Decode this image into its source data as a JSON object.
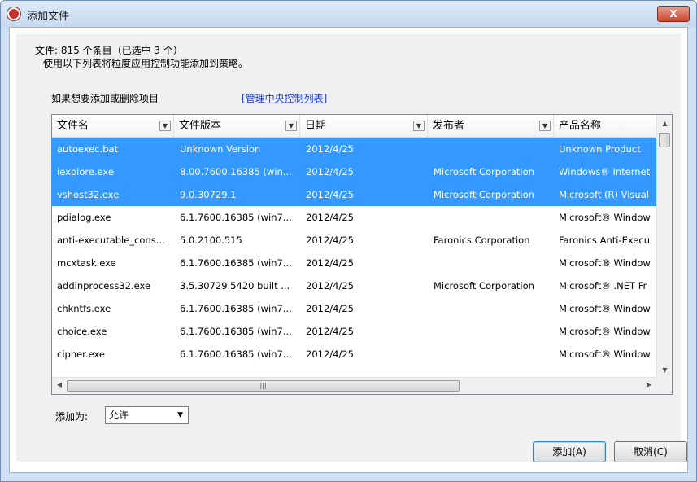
{
  "window": {
    "title": "添加文件",
    "close_label": "X"
  },
  "info": {
    "file_count": "文件: 815 个条目（已选中 3 个）",
    "instruction": "使用以下列表将粒度应用控制功能添加到策略。"
  },
  "edit": {
    "hint": "如果想要添加或删除项目",
    "link": "[管理中央控制列表]"
  },
  "table": {
    "columns": [
      "文件名",
      "文件版本",
      "日期",
      "发布者",
      "产品名称"
    ],
    "rows": [
      {
        "name": "autoexec.bat",
        "version": "Unknown Version",
        "date": "2012/4/25",
        "publisher": "",
        "product": "Unknown Product",
        "selected": true
      },
      {
        "name": "iexplore.exe",
        "version": "8.00.7600.16385 (win...",
        "date": "2012/4/25",
        "publisher": "Microsoft Corporation",
        "product": "Windows® Internet",
        "selected": true
      },
      {
        "name": "vshost32.exe",
        "version": "9.0.30729.1",
        "date": "2012/4/25",
        "publisher": "Microsoft Corporation",
        "product": "Microsoft (R) Visual",
        "selected": true
      },
      {
        "name": "pdialog.exe",
        "version": "6.1.7600.16385 (win7...",
        "date": "2012/4/25",
        "publisher": "",
        "product": "Microsoft® Window",
        "selected": false
      },
      {
        "name": "anti-executable_cons...",
        "version": "5.0.2100.515",
        "date": "2012/4/25",
        "publisher": "Faronics Corporation",
        "product": "Faronics Anti-Execu",
        "selected": false
      },
      {
        "name": "mcxtask.exe",
        "version": "6.1.7600.16385 (win7...",
        "date": "2012/4/25",
        "publisher": "",
        "product": "Microsoft® Window",
        "selected": false
      },
      {
        "name": "addinprocess32.exe",
        "version": "3.5.30729.5420 built ...",
        "date": "2012/4/25",
        "publisher": "Microsoft Corporation",
        "product": "Microsoft® .NET Fr",
        "selected": false
      },
      {
        "name": "chkntfs.exe",
        "version": "6.1.7600.16385 (win7...",
        "date": "2012/4/25",
        "publisher": "",
        "product": "Microsoft® Window",
        "selected": false
      },
      {
        "name": "choice.exe",
        "version": "6.1.7600.16385 (win7...",
        "date": "2012/4/25",
        "publisher": "",
        "product": "Microsoft® Window",
        "selected": false
      },
      {
        "name": "cipher.exe",
        "version": "6.1.7600.16385 (win7...",
        "date": "2012/4/25",
        "publisher": "",
        "product": "Microsoft® Window",
        "selected": false
      }
    ]
  },
  "add_as": {
    "label": "添加为:",
    "selected": "允许"
  },
  "buttons": {
    "add": "添加(A)",
    "cancel": "取消(C)"
  },
  "colors": {
    "selection": "#3399ff",
    "link": "#1a40c0"
  }
}
